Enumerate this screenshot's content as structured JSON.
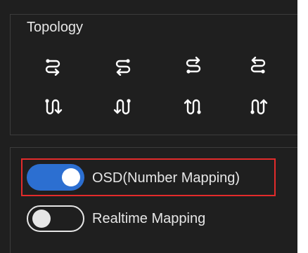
{
  "topology": {
    "title": "Topology",
    "buttons": [
      {
        "icon": "serpentine-right-down-icon"
      },
      {
        "icon": "serpentine-left-down-icon"
      },
      {
        "icon": "serpentine-right-up-icon"
      },
      {
        "icon": "serpentine-left-up-icon"
      },
      {
        "icon": "serpentine-down-right-icon"
      },
      {
        "icon": "serpentine-down-left-icon"
      },
      {
        "icon": "serpentine-up-right-icon"
      },
      {
        "icon": "serpentine-up-left-icon"
      }
    ]
  },
  "mapping": {
    "osd_label": "OSD(Number Mapping)",
    "osd_on": true,
    "realtime_label": "Realtime Mapping",
    "realtime_on": false
  },
  "colors": {
    "background": "#1f1f1f",
    "text": "#e6e6e6",
    "toggle_on": "#2c6fd1",
    "highlight": "#e32b2b"
  }
}
